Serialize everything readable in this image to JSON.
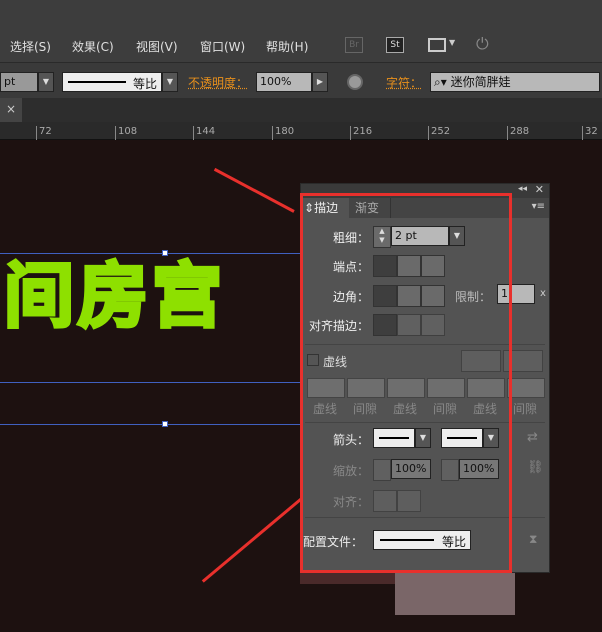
{
  "menu": [
    "选择(S)",
    "效果(C)",
    "视图(V)",
    "窗口(W)",
    "帮助(H)"
  ],
  "menu_icons": {
    "br": "Br",
    "st": "St"
  },
  "control": {
    "unit": "pt",
    "stroke_profile": "等比",
    "opacity_label": "不透明度：",
    "opacity": "100%",
    "char_label": "字符：",
    "font": "迷你简胖娃"
  },
  "tab_close": "×",
  "ruler": [
    "72",
    "108",
    "144",
    "180",
    "216",
    "252",
    "288",
    "32"
  ],
  "canvas_text": "间房宫",
  "panel": {
    "tabs": [
      "描边",
      "渐变"
    ],
    "weight_label": "粗细：",
    "weight": "2 pt",
    "cap_label": "端点：",
    "corner_label": "边角：",
    "limit_label": "限制：",
    "limit": "1",
    "limit_unit": "x",
    "align_label": "对齐描边：",
    "dashed_label": "虚线",
    "dash_labels": [
      "虚线",
      "间隙",
      "虚线",
      "间隙",
      "虚线",
      "间隙"
    ],
    "arrow_label": "箭头：",
    "scale_label": "缩放：",
    "scale1": "100%",
    "scale2": "100%",
    "arrow_align_label": "对齐：",
    "profile_label": "配置文件：",
    "profile": "等比"
  },
  "colors": {
    "highlight": "#e8302c",
    "stroke": "#8ee000",
    "fill": "#564400"
  }
}
